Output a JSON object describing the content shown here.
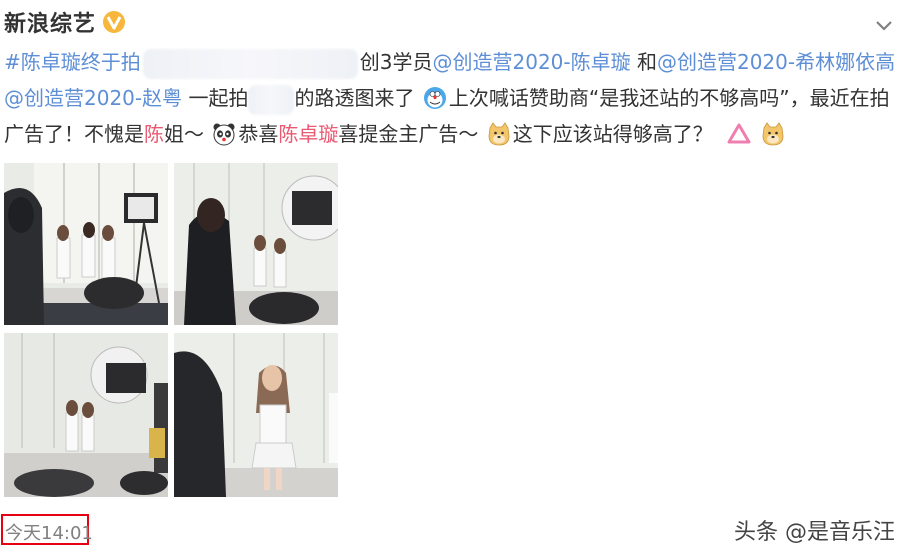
{
  "post": {
    "author": "新浪综艺",
    "verified_icon": "verified-v-icon",
    "more_icon": "chevron-down-icon",
    "text": {
      "hashtag": "#陈卓璇",
      "t1": "终于拍",
      "t2": "创3学员",
      "mention1": "@创造营2020-陈卓璇",
      "t3": " 和",
      "mention2": "@创造营2020-希林娜依高",
      "t4": " ",
      "mention3": "@创造营2020-赵粤",
      "t5": " 一起拍",
      "t6": "的路透图来了",
      "t7": "上次喊话赞助商“是我还站的不够高吗”，最近在拍广告了！不愧是",
      "red1": "陈",
      "t8": "姐～",
      "t9": "恭喜",
      "red2": "陈卓璇",
      "t10": "喜提金主广告～",
      "t11": "这下应该站得够高了？"
    },
    "emojis": [
      "doraemon-icon",
      "panda-icon",
      "doge-icon",
      "triangle-icon",
      "doge-icon"
    ],
    "photos": [
      "photo-1",
      "photo-2",
      "photo-3",
      "photo-4"
    ],
    "time": "今天14:01",
    "watermark": "头条 @是音乐汪"
  },
  "colors": {
    "link": "#5e8fd6",
    "highlight": "#e95a72",
    "verified": "#f6b73c",
    "time_box": "#e60012"
  }
}
